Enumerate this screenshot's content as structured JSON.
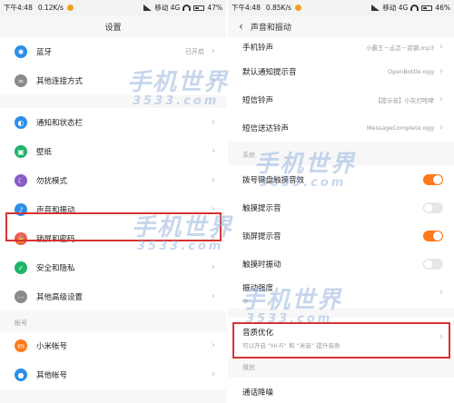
{
  "left": {
    "status": {
      "time": "下午4:48",
      "speed": "0.12K/s",
      "carrier": "移动 4G",
      "battery": "47%"
    },
    "title": "设置",
    "group1": [
      {
        "label": "蓝牙",
        "value": "已开启",
        "icon_color": "#2b8fe8",
        "icon": "bluetooth-icon",
        "glyph": "✱"
      },
      {
        "label": "其他连接方式",
        "value": "",
        "icon_color": "#8a8a8a",
        "icon": "connection-icon",
        "glyph": "∞"
      }
    ],
    "group2": [
      {
        "label": "通知和状态栏",
        "icon_color": "#2b8fe8",
        "icon": "notification-icon",
        "glyph": "◐"
      },
      {
        "label": "壁纸",
        "icon_color": "#1fb36a",
        "icon": "wallpaper-icon",
        "glyph": "▣"
      },
      {
        "label": "勿扰模式",
        "icon_color": "#8a5cc8",
        "icon": "moon-icon",
        "glyph": "☾"
      },
      {
        "label": "声音和振动",
        "icon_color": "#2b8fe8",
        "icon": "sound-icon",
        "glyph": "♪"
      },
      {
        "label": "锁屏和密码",
        "icon_color": "#ef5b4e",
        "icon": "lock-icon",
        "glyph": "🔒"
      },
      {
        "label": "安全和隐私",
        "icon_color": "#1fb36a",
        "icon": "shield-icon",
        "glyph": "✓"
      },
      {
        "label": "其他高级设置",
        "icon_color": "#8a8a8a",
        "icon": "more-icon",
        "glyph": "⋯"
      }
    ],
    "section_account": "帐号",
    "group3": [
      {
        "label": "小米帐号",
        "icon_color": "#ff7a1a",
        "icon": "mi-account-icon",
        "glyph": "m"
      },
      {
        "label": "其他帐号",
        "icon_color": "#2b8fe8",
        "icon": "account-icon",
        "glyph": "●"
      }
    ]
  },
  "right": {
    "status": {
      "time": "下午4:48",
      "speed": "0.85K/s",
      "carrier": "移动 4G",
      "battery": "46%"
    },
    "title": "声音和振动",
    "rows_top": [
      {
        "label": "手机铃声",
        "value": "小霸王－忐忑－前钢.mp3"
      },
      {
        "label": "默认通知提示音",
        "value": "OpenBottle.ogg"
      },
      {
        "label": "短信铃声",
        "value": "【提示音】小灰灯咆哮"
      },
      {
        "label": "短信送达铃声",
        "value": "MessageComplete.ogg"
      }
    ],
    "section_system": "系统",
    "toggles": [
      {
        "label": "拨号键盘触摸音效",
        "state": "on"
      },
      {
        "label": "触摸提示音",
        "state": "off"
      },
      {
        "label": "锁屏提示音",
        "state": "on"
      },
      {
        "label": "触摸时振动",
        "state": "off"
      }
    ],
    "vibration_row": {
      "label": "振动强度",
      "sub": "中"
    },
    "audio_opt": {
      "label": "音质优化",
      "sub": "可以开启 “Hi-Fi” 和 “米音” 提升音质"
    },
    "section_bottom": "播放",
    "bottom_row": {
      "label": "通话降噪"
    }
  },
  "watermark": {
    "main": "手机世界",
    "sub": "3533.com"
  },
  "colors": {
    "highlight": "#d93232",
    "accent": "#ff7a1a"
  }
}
